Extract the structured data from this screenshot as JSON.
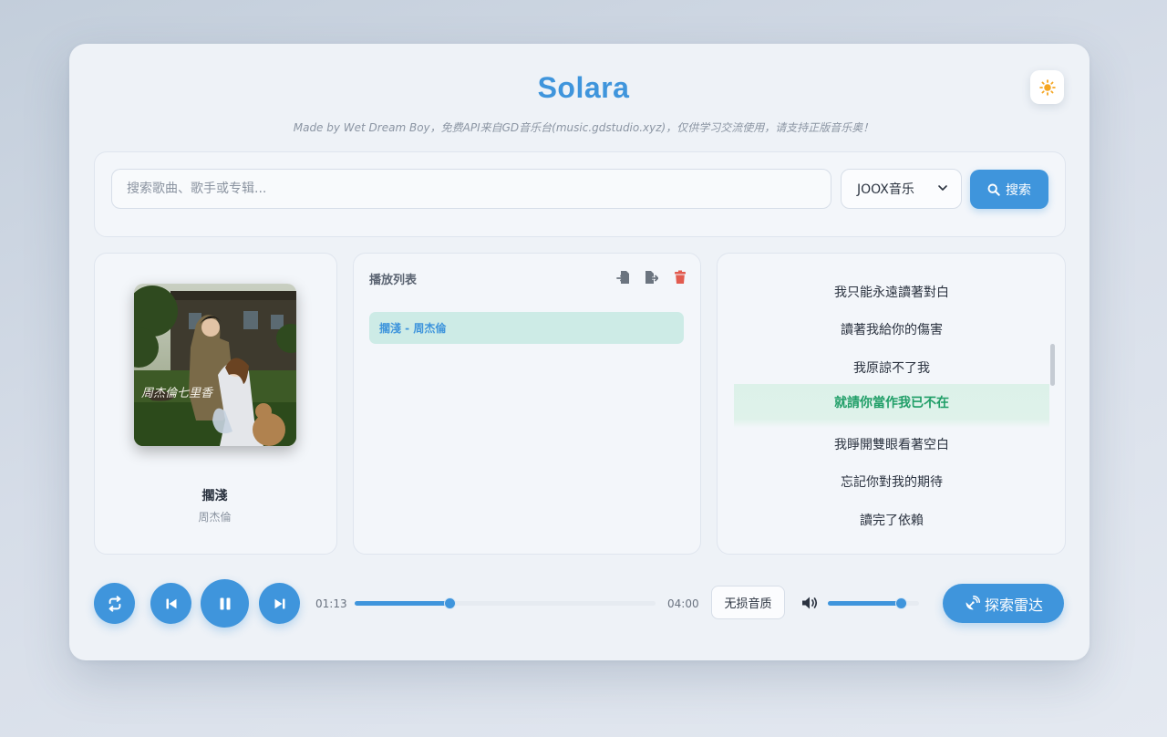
{
  "app": {
    "title": "Solara",
    "subtitle": "Made by Wet Dream Boy，免费API来自GD音乐台(music.gdstudio.xyz)，仅供学习交流使用，请支持正版音乐奥！",
    "theme_icon": "sun-icon",
    "accent_color": "#3f95dc"
  },
  "search": {
    "placeholder": "搜索歌曲、歌手或专辑...",
    "value": "",
    "source_selected": "JOOX音乐",
    "button_label": "搜索"
  },
  "now_playing": {
    "title": "擱淺",
    "artist": "周杰倫",
    "cover_text": "周杰倫七里香"
  },
  "playlist": {
    "title": "播放列表",
    "items": [
      {
        "label": "擱淺 - 周杰倫",
        "active": true
      }
    ]
  },
  "lyrics": {
    "lines": [
      "我只能永遠讀著對白",
      "讀著我給你的傷害",
      "我原諒不了我",
      "就請你當作我已不在",
      "我睜開雙眼看著空白",
      "忘記你對我的期待",
      "讀完了依賴"
    ],
    "active_index": 3,
    "active_color": "#1f9e67"
  },
  "player": {
    "current_time": "01:13",
    "total_time": "04:00",
    "progress": 0.315,
    "quality_label": "无损音质",
    "volume": 0.8,
    "radar_label": "探索雷达"
  }
}
